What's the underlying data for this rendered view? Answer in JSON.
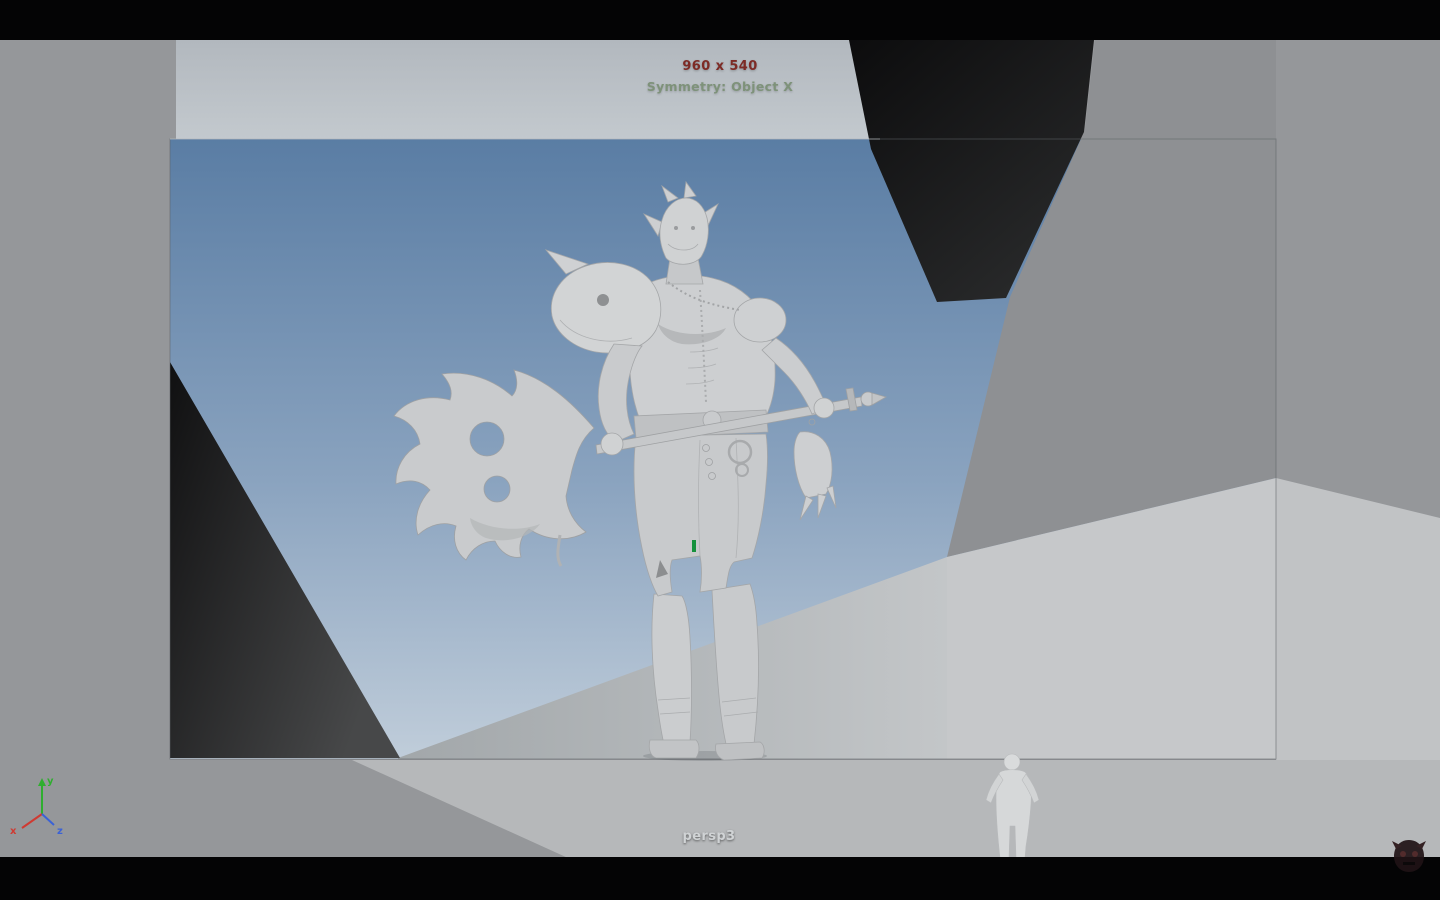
{
  "hud": {
    "resolution_label": "960 x 540",
    "symmetry_label": "Symmetry: Object X",
    "camera_label": "persp3"
  },
  "axis_gizmo": {
    "x": "x",
    "y": "y",
    "z": "z"
  },
  "colors": {
    "resolution_text": "#7d2b26",
    "symmetry_text": "#7e927a",
    "camera_text": "#d0d3d5",
    "letterbox": "#040405",
    "viewport_base": "#95979a",
    "sky_top": "#5a7da4",
    "sky_bottom": "#c0cdda",
    "left_wall_dark": "#141415",
    "rock_dark": "#0d0d0e",
    "right_wall_light": "#c6c8ca",
    "floor_light": "#b6b8ba",
    "model_gray": "#cdcfd1",
    "selection_green": "#15913d",
    "axis_x_red": "#cf3a32",
    "axis_y_green": "#2fae2f",
    "axis_z_blue": "#3b62d6"
  }
}
